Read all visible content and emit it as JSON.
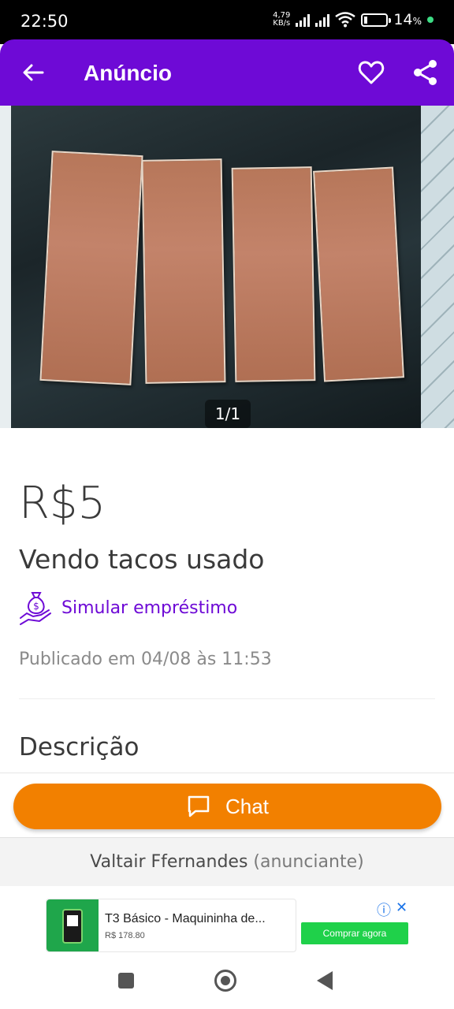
{
  "status_bar": {
    "time": "22:50",
    "net_speed_value": "4,79",
    "net_speed_unit": "KB/s",
    "battery_percent": "14",
    "battery_percent_sign": "%"
  },
  "header": {
    "title": "Anúncio",
    "back_icon": "arrow-left-icon",
    "favorite_icon": "heart-outline-icon",
    "share_icon": "share-icon",
    "background_color": "#6e0ad6"
  },
  "gallery": {
    "counter": "1/1"
  },
  "listing": {
    "price": "R$5",
    "title": "Vendo tacos usado",
    "loan_link": "Simular empréstimo",
    "published": "Publicado em 04/08 às 11:53",
    "description_heading": "Descrição"
  },
  "actions": {
    "chat_label": "Chat",
    "chat_color": "#f28000"
  },
  "seller": {
    "name": "Valtair Ffernandes",
    "role": "(anunciante)"
  },
  "ad": {
    "title": "T3 Básico - Maquininha de...",
    "price": "R$ 178.80",
    "cta": "Comprar agora",
    "info_icon": "ⓘ",
    "close_icon": "✕"
  }
}
